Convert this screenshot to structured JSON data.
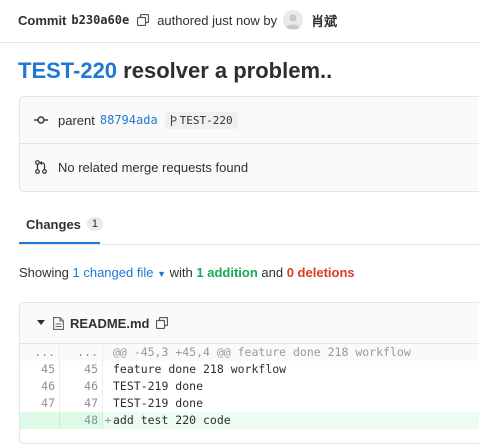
{
  "header": {
    "commit_word": "Commit",
    "sha": "b230a60e",
    "authored_text": "authored just now by",
    "author": "肖斌"
  },
  "title": {
    "key": "TEST-220",
    "rest": " resolver a problem.."
  },
  "info": {
    "parent_label": "parent",
    "parent_sha": "88794ada",
    "branch_tag": "TEST-220",
    "merge_text": "No related merge requests found"
  },
  "tabs": {
    "changes_label": "Changes",
    "changes_count": "1"
  },
  "showing": {
    "prefix": "Showing",
    "changed_files": "1 changed file",
    "with": "with",
    "additions": "1 addition",
    "and": "and",
    "deletions": "0 deletions"
  },
  "file": {
    "name": "README.md",
    "lines": [
      {
        "old": "...",
        "new": "...",
        "sign": "",
        "text": "@@ -45,3 +45,4 @@ feature done 218 workflow",
        "kind": "match"
      },
      {
        "old": "45",
        "new": "45",
        "sign": "",
        "text": "feature done 218 workflow",
        "kind": "ctx"
      },
      {
        "old": "46",
        "new": "46",
        "sign": "",
        "text": "TEST-219 done",
        "kind": "ctx"
      },
      {
        "old": "47",
        "new": "47",
        "sign": "",
        "text": "TEST-219 done",
        "kind": "ctx"
      },
      {
        "old": "",
        "new": "48",
        "sign": "+",
        "text": "add test 220 code",
        "kind": "add"
      }
    ]
  },
  "colors": {
    "link": "#1f78d1",
    "addition": "#1aaa55",
    "deletion": "#db3b21",
    "added_line_bg": "#ecfdf0"
  },
  "icons": [
    "copy-icon",
    "avatar-icon",
    "commit-icon",
    "merge-request-icon",
    "branch-icon",
    "chevron-down-icon",
    "file-icon"
  ]
}
